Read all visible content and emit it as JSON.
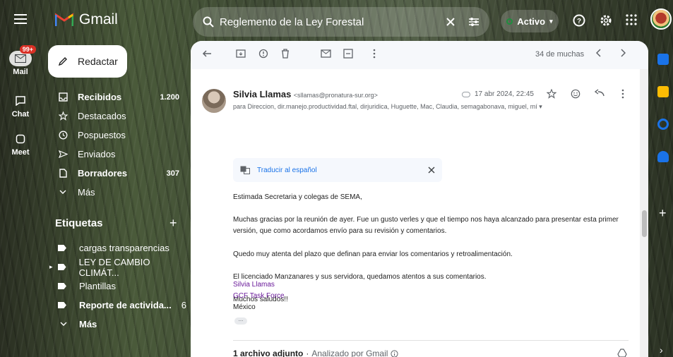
{
  "rail": {
    "mail_label": "Mail",
    "mail_badge": "99+",
    "chat_label": "Chat",
    "meet_label": "Meet"
  },
  "header": {
    "app_name": "Gmail",
    "search_query": "Reglemento de la Ley Forestal",
    "status_label": "Activo"
  },
  "compose_label": "Redactar",
  "nav": [
    {
      "label": "Recibidos",
      "count": "1.200",
      "icon": "inbox-icon",
      "bold": true
    },
    {
      "label": "Destacados",
      "count": "",
      "icon": "star-icon",
      "bold": false
    },
    {
      "label": "Pospuestos",
      "count": "",
      "icon": "clock-icon",
      "bold": false
    },
    {
      "label": "Enviados",
      "count": "",
      "icon": "send-icon",
      "bold": false
    },
    {
      "label": "Borradores",
      "count": "307",
      "icon": "draft-icon",
      "bold": true
    },
    {
      "label": "Más",
      "count": "",
      "icon": "chevron-down-icon",
      "bold": false
    }
  ],
  "labels_title": "Etiquetas",
  "labels": [
    {
      "label": "cargas transparencias",
      "count": "",
      "bold": false
    },
    {
      "label": "LEY DE CAMBIO CLIMÁT...",
      "count": "",
      "bold": false
    },
    {
      "label": "Plantillas",
      "count": "",
      "bold": false
    },
    {
      "label": "Reporte de activida...",
      "count": "6",
      "bold": true
    }
  ],
  "labels_more": "Más",
  "toolbar": {
    "count_text": "34 de muchas"
  },
  "message": {
    "sender_name": "Silvia Llamas",
    "sender_email": "<sllamas@pronatura-sur.org>",
    "date": "17 abr 2024, 22:45",
    "recipients": "para Direccion, dir.manejo.productividad.ftal, dirjuridica, Huguette, Mac, Claudia, semagabonava, miguel, mí",
    "translate_label": "Traducir al español",
    "greeting": "Estimada Secretaria y colegas de SEMA,",
    "paragraph1": "Muchas gracias por la reunión de ayer. Fue un gusto verles y que el tiempo nos haya alcanzado para presentar esta primer versión, que como acordamos envío para su revisión y comentarios.",
    "paragraph2": "Quedo muy atenta del  plazo que definan para enviar los comentarios y retroalimentación.",
    "paragraph3": "El licenciado Manzanares y sus servidora, quedamos atentos a sus comentarios.",
    "closing": "Muchos saludos!!",
    "sig_name": "Silvia Llamas",
    "sig_org": "GCF Task Force",
    "sig_country": "México",
    "more_dots": "...",
    "attachment_title": "1 archivo adjunto",
    "attachment_note": "Analizado por Gmail"
  },
  "colors": {
    "accent_blue": "#1a73e8",
    "signature_purple": "#6a1b9a",
    "badge_red": "#d93025",
    "status_green": "#1e8e3e"
  }
}
